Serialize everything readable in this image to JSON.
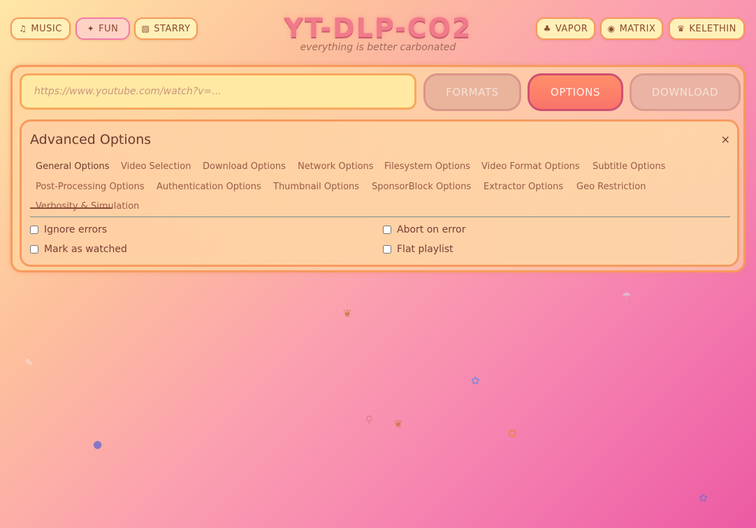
{
  "themes_left": [
    {
      "icon": "♫",
      "label": "MUSIC"
    },
    {
      "icon": "✦",
      "label": "FUN"
    },
    {
      "icon": "▨",
      "label": "STARRY"
    }
  ],
  "themes_right": [
    {
      "icon": "♣",
      "label": "VAPOR"
    },
    {
      "icon": "◉",
      "label": "MATRIX"
    },
    {
      "icon": "♛",
      "label": "KELETHIN"
    }
  ],
  "brand": {
    "title": "YT-DLP-CO2",
    "subtitle": "everything is better carbonated"
  },
  "url_input": {
    "placeholder": "https://www.youtube.com/watch?v=...",
    "value": ""
  },
  "actions": {
    "formats": "FORMATS",
    "options": "OPTIONS",
    "download": "DOWNLOAD"
  },
  "advanced": {
    "title": "Advanced Options",
    "close_glyph": "×",
    "tabs_row1": [
      "General Options",
      "Video Selection",
      "Download Options",
      "Network Options",
      "Filesystem Options",
      "Video Format Options",
      "Subtitle Options"
    ],
    "tabs_row2": [
      "Post-Processing Options",
      "Authentication Options",
      "Thumbnail Options",
      "SponsorBlock Options",
      "Extractor Options",
      "Geo Restriction"
    ],
    "tabs_row3": [
      "Verbosity & Simulation"
    ],
    "active_tab": "General Options",
    "checkboxes": [
      {
        "label": "Ignore errors",
        "checked": false
      },
      {
        "label": "Abort on error",
        "checked": false
      },
      {
        "label": "Mark as watched",
        "checked": false
      },
      {
        "label": "Flat playlist",
        "checked": false
      }
    ]
  },
  "colors": {
    "accent": "#f79a5e",
    "active_button": "#f9746a",
    "brand_title": "#f07a8a"
  }
}
